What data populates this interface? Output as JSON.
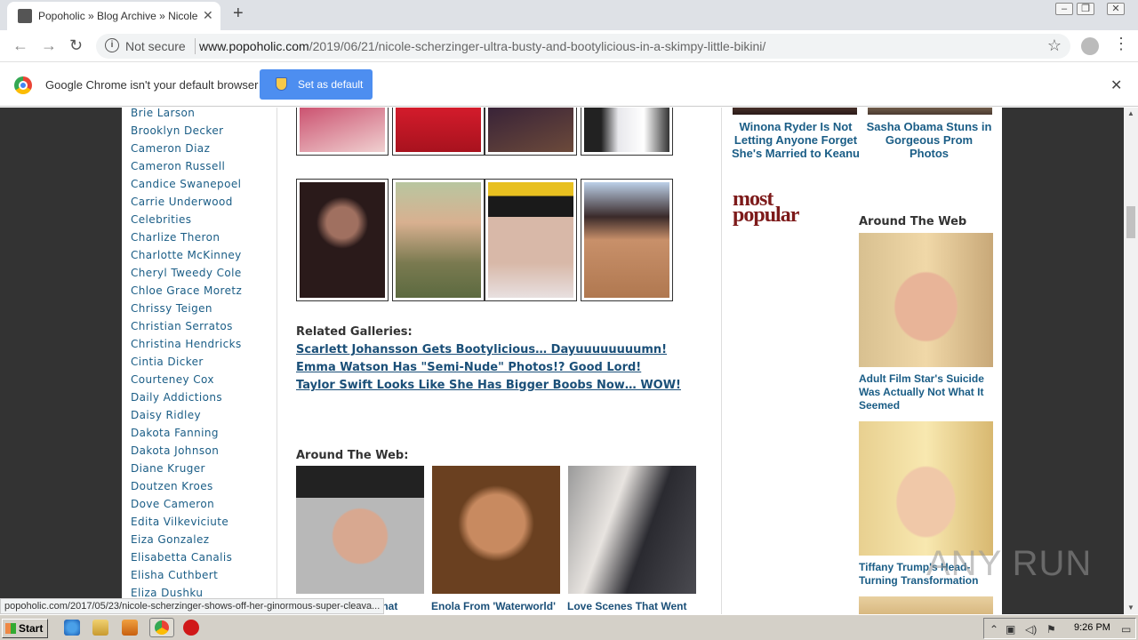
{
  "browser": {
    "tab_title": "Popoholic » Blog Archive » Nicole Sch",
    "security_label": "Not secure",
    "url_host": "www.popoholic.com",
    "url_path": "/2019/06/21/nicole-scherzinger-ultra-busty-and-bootylicious-in-a-skimpy-little-bikini/",
    "infobar_message": "Google Chrome isn't your default browser",
    "infobar_button": "Set as default",
    "status_url": "popoholic.com/2017/05/23/nicole-scherzinger-shows-off-her-ginormous-super-cleava..."
  },
  "sidebar": {
    "items": [
      "Brie Larson",
      "Brooklyn Decker",
      "Cameron Diaz",
      "Cameron Russell",
      "Candice Swanepoel",
      "Carrie Underwood",
      "Celebrities",
      "Charlize Theron",
      "Charlotte McKinney",
      "Cheryl Tweedy Cole",
      "Chloe Grace Moretz",
      "Chrissy Teigen",
      "Christian Serratos",
      "Christina Hendricks",
      "Cintia Dicker",
      "Courteney Cox",
      "Daily Addictions",
      "Daisy Ridley",
      "Dakota Fanning",
      "Dakota Johnson",
      "Diane Kruger",
      "Doutzen Kroes",
      "Dove Cameron",
      "Edita Vilkeviciute",
      "Eiza Gonzalez",
      "Elisabetta Canalis",
      "Elisha Cuthbert",
      "Eliza Dushku"
    ]
  },
  "main": {
    "related_heading": "Related Galleries:",
    "related_links": [
      "Scarlett Johansson Gets Bootylicious… Dayuuuuuuuumn!",
      "Emma Watson Has \"Semi-Nude\" Photos!? Good Lord!",
      "Taylor Swift Looks Like She Has Bigger Boobs Now… WOW!"
    ],
    "around_heading": "Around The Web:",
    "around_captions": [
      "That",
      "Enola From 'Waterworld'",
      "Love Scenes That Went"
    ]
  },
  "right": {
    "ad_captions": [
      "Winona Ryder Is Not Letting Anyone Forget She's Married to Keanu",
      "Sasha Obama Stuns in Gorgeous Prom Photos"
    ],
    "most_popular_line1": "most",
    "most_popular_line2": "popular",
    "around_heading": "Around The Web",
    "around_items": [
      "Adult Film Star's Suicide Was Actually Not What It Seemed",
      "Tiffany Trump's Head-Turning Transformation"
    ]
  },
  "taskbar": {
    "start_label": "Start",
    "clock": "9:26 PM"
  },
  "watermark": "ANY RUN",
  "colors": {
    "link": "#1a4f78",
    "sidebar_link": "#1a5d86",
    "most_popular": "#7d1a1a",
    "chrome_button": "#4d8ef0"
  }
}
